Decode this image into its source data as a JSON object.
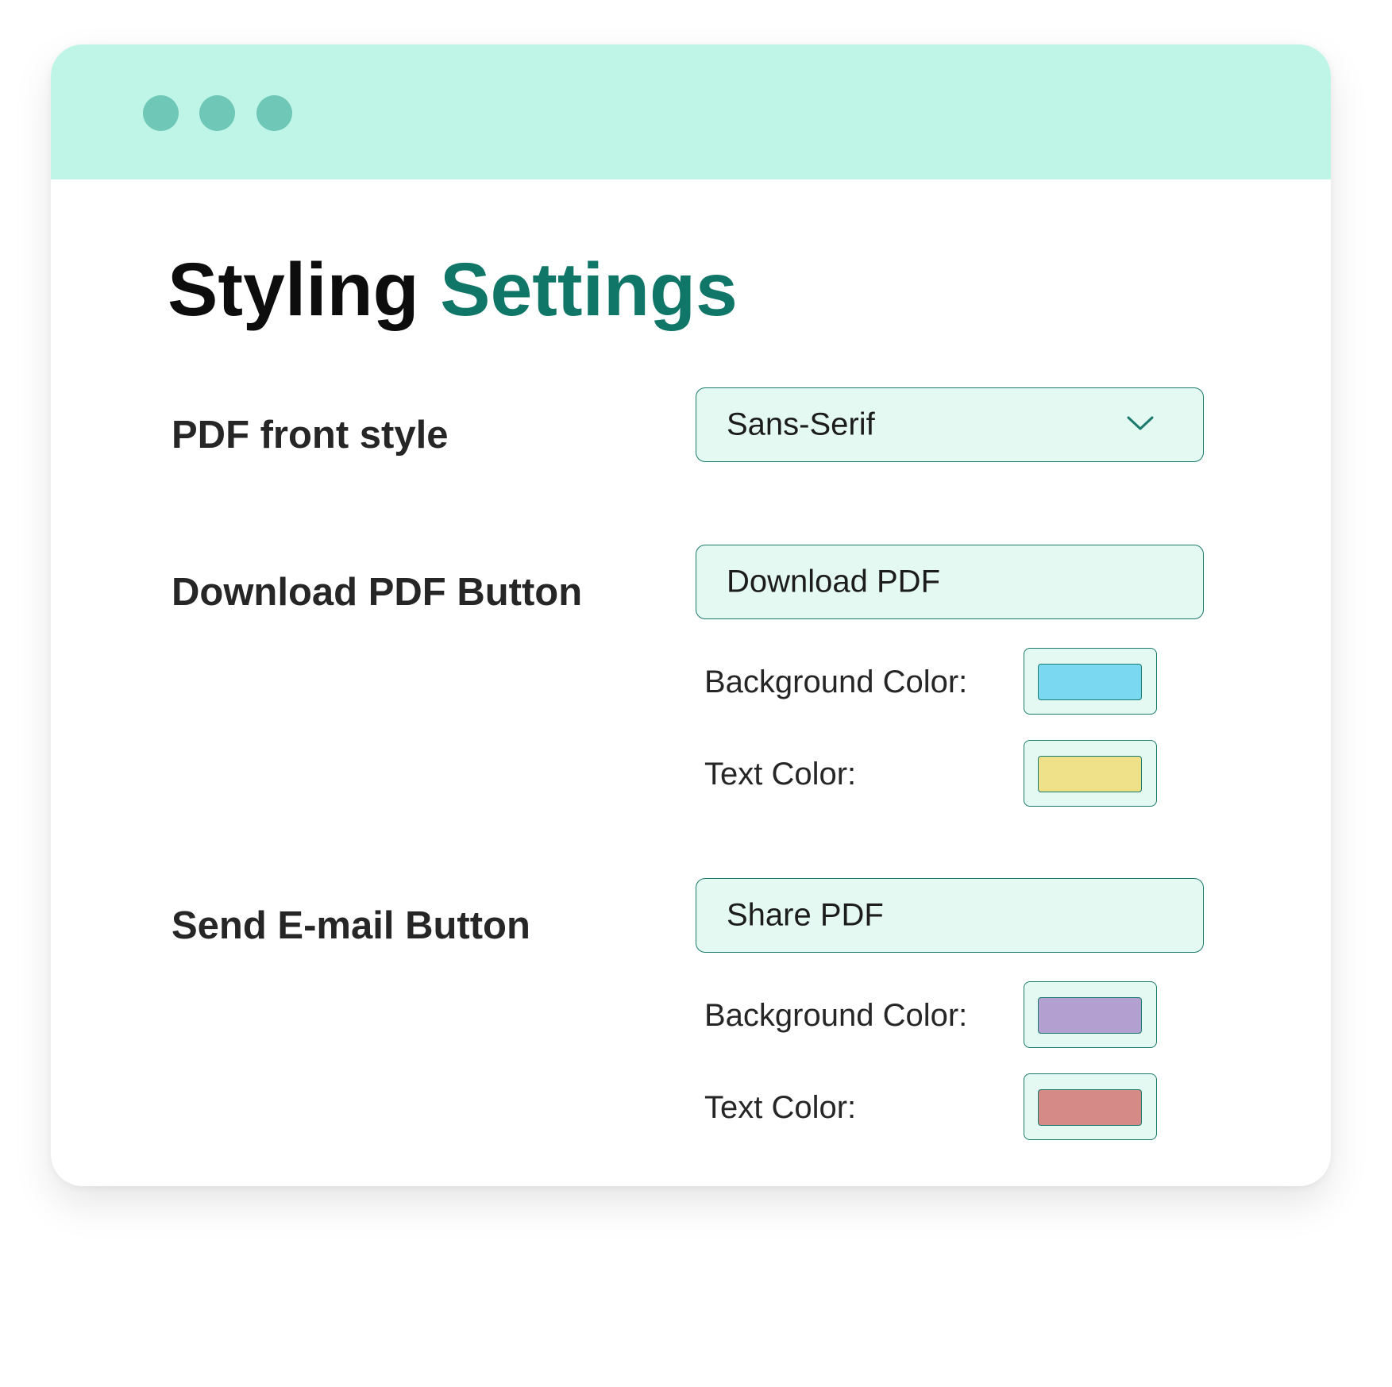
{
  "window": {
    "controls": [
      "window-dot",
      "window-dot",
      "window-dot"
    ],
    "dot_color": "#6fc7b8",
    "titlebar_color": "#bff5e6"
  },
  "page": {
    "title_part1": "Styling",
    "title_part2": "Settings",
    "accent_color": "#0f7668"
  },
  "settings": {
    "font_style": {
      "label": "PDF front style",
      "value": "Sans-Serif",
      "icon": "chevron-down-icon"
    },
    "download_button": {
      "label": "Download PDF Button",
      "value": "Download PDF",
      "background_label": "Background Color:",
      "background_color": "#7ad8f0",
      "text_label": "Text Color:",
      "text_color": "#eee18a"
    },
    "email_button": {
      "label": "Send E-mail Button",
      "value": "Share PDF",
      "background_label": "Background Color:",
      "background_color": "#b3a0d1",
      "text_label": "Text Color:",
      "text_color": "#d68a87"
    }
  }
}
